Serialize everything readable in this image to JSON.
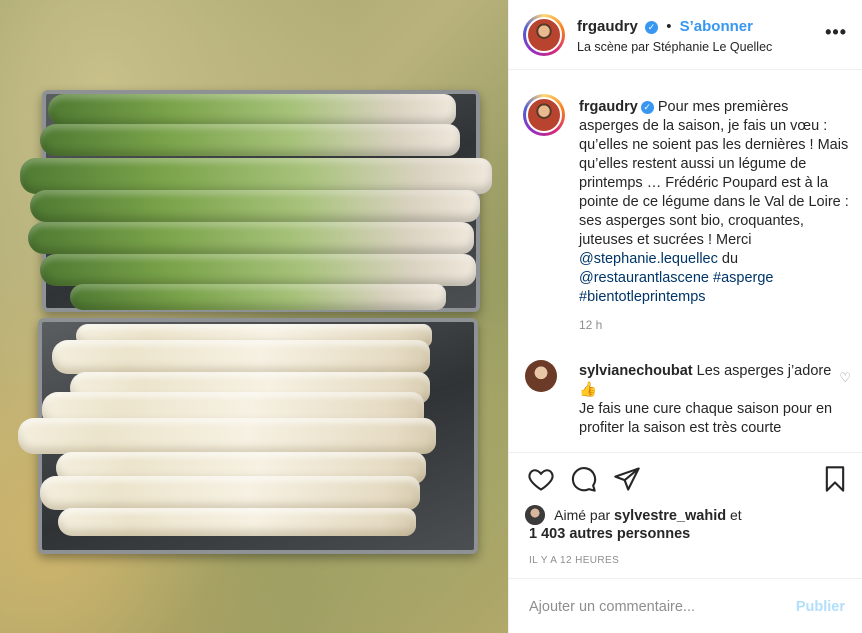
{
  "post": {
    "username": "frgaudry",
    "follow_label": "S’abonner",
    "location": "La scène par Stéphanie Le Quellec",
    "more_label": "•••",
    "photo_alt_icon": "asparagus-photo"
  },
  "caption": {
    "username": "frgaudry",
    "text": "Pour mes premières asperges de la saison, je fais un vœu : qu’elles ne soient pas les dernières ! Mais qu’elles restent aussi un légume de printemps … Frédéric Poupard est à la pointe de ce légume dans le Val de Loire : ses asperges sont bio, croquantes, juteuses et sucrées ! Merci",
    "mention1": "@stephanie.lequellec",
    "du": " du ",
    "mention2": "@restaurantlascene",
    "tag1": "#asperge",
    "tag2": "#bientotleprintemps",
    "time": "12 h"
  },
  "comment": {
    "username": "sylvianechoubat",
    "text1": "Les asperges j’adore 👍",
    "text2": "Je fais une cure chaque saison pour en profiter la saison est très courte"
  },
  "likes": {
    "prefix": "Aimé par",
    "user": "sylvestre_wahid",
    "suffix": "et",
    "others": "1 403 autres personnes",
    "ago": "IL Y A 12 HEURES"
  },
  "add_comment": {
    "placeholder": "Ajouter un commentaire...",
    "publish": "Publier"
  },
  "colors": {
    "accent": "#3897f0",
    "link": "#003569",
    "muted": "#8e8e8e",
    "publish_disabled": "#b2dffc"
  }
}
